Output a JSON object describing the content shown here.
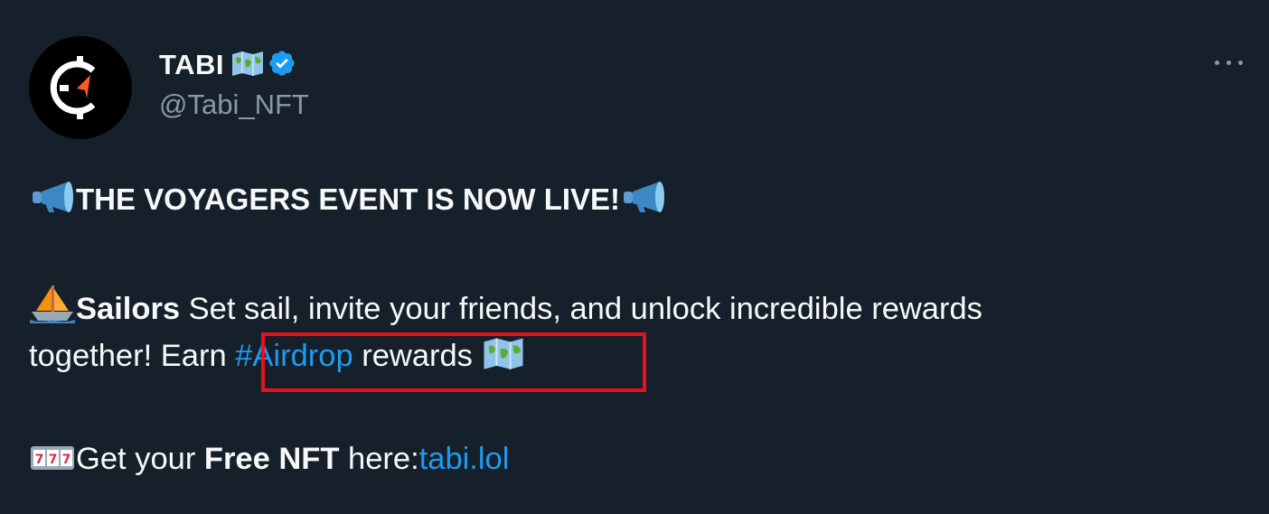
{
  "tweet": {
    "display_name": "TABI",
    "handle": "@Tabi_NFT",
    "headline": "THE VOYAGERS EVENT IS NOW LIVE!",
    "para1_bold": "Sailors",
    "para1_text": " Set sail, invite your friends,  and unlock incredible rewards",
    "para2_text": "together! Earn ",
    "hashtag": "#Airdrop",
    "para2_after": " rewards ",
    "para3_text": "Get your ",
    "para3_bold": "Free NFT",
    "para3_mid": " here:",
    "link": "tabi.lol"
  },
  "icons": {
    "more": "more-horizontal-icon",
    "verified": "verified-badge-icon",
    "map": "world-map-emoji",
    "megaphone": "megaphone-emoji",
    "sailboat": "sailboat-emoji",
    "slot": "slot-machine-emoji"
  },
  "colors": {
    "background": "#15202b",
    "text": "#f7f9f9",
    "secondary": "#8b98a5",
    "link": "#1d9bf0",
    "highlight_box": "#e3121e"
  }
}
